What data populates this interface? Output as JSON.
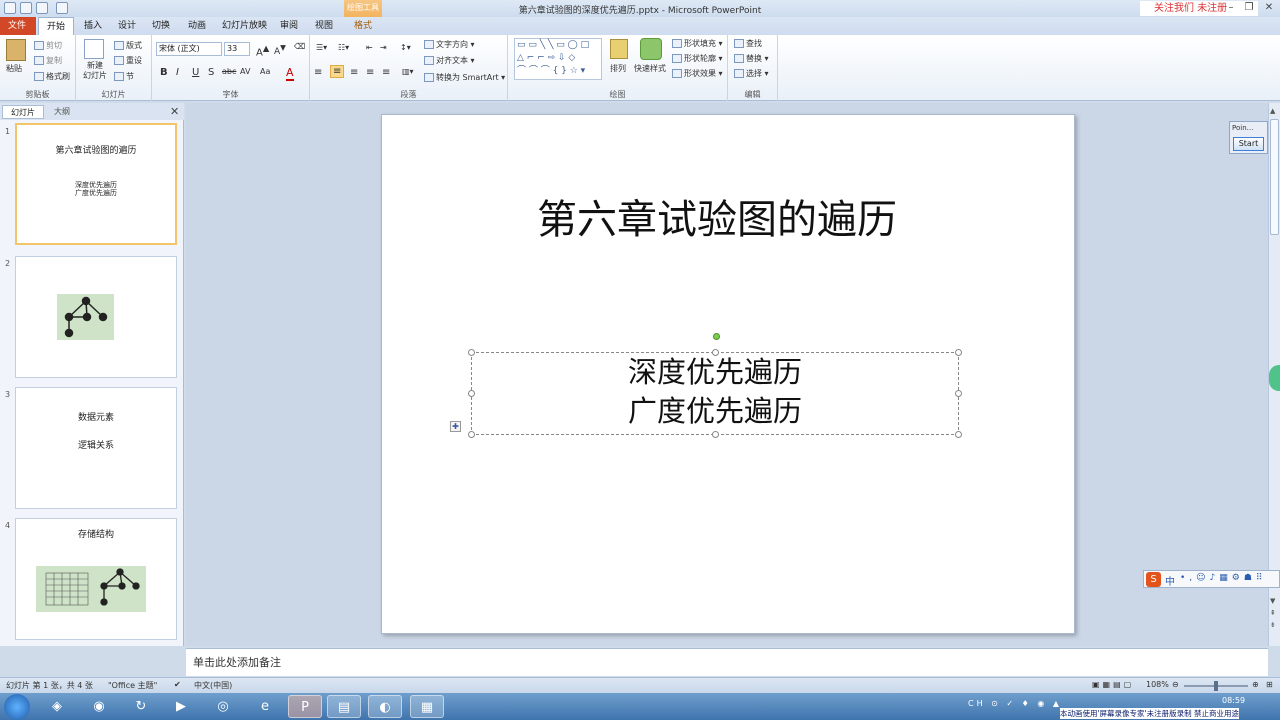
{
  "window": {
    "title": "第六章试验图的深度优先遍历.pptx - Microsoft PowerPoint",
    "context_tab_header": "绘图工具",
    "watermark": "关注我们 未注册"
  },
  "tabs": [
    "文件",
    "开始",
    "插入",
    "设计",
    "切换",
    "动画",
    "幻灯片放映",
    "审阅",
    "视图",
    "格式"
  ],
  "ribbon": {
    "clipboard": {
      "paste": "粘贴",
      "cut": "剪切",
      "copy": "复制",
      "format_painter": "格式刷",
      "label": "剪贴板"
    },
    "slides": {
      "new_slide": "新建\n幻灯片",
      "layout": "版式",
      "reset": "重设",
      "section": "节",
      "label": "幻灯片"
    },
    "font": {
      "family": "宋体 (正文)",
      "size": "33",
      "label": "字体",
      "buttons": [
        "B",
        "I",
        "U",
        "S",
        "abc",
        "AV",
        "Aa",
        "A"
      ]
    },
    "paragraph": {
      "text_direction": "文字方向",
      "align_text": "对齐文本",
      "smartart": "转换为 SmartArt",
      "label": "段落"
    },
    "drawing": {
      "arrange": "排列",
      "quick_styles": "快速样式",
      "shape_fill": "形状填充",
      "shape_outline": "形状轮廓",
      "shape_effects": "形状效果",
      "label": "绘图"
    },
    "editing": {
      "find": "查找",
      "replace": "替换",
      "select": "选择",
      "label": "编辑"
    }
  },
  "pane": {
    "tabs": [
      "幻灯片",
      "大纲"
    ]
  },
  "thumbnails": [
    {
      "num": "1",
      "title": "第六章试验图的遍历",
      "lines": [
        "深度优先遍历",
        "广度优先遍历"
      ]
    },
    {
      "num": "2"
    },
    {
      "num": "3",
      "lines": [
        "数据元素",
        "逻辑关系"
      ]
    },
    {
      "num": "4",
      "title": "存储结构"
    }
  ],
  "slide": {
    "title": "第六章试验图的遍历",
    "body_line1": "深度优先遍历",
    "body_line2": "广度优先遍历"
  },
  "notes_placeholder": "单击此处添加备注",
  "status": {
    "slide_info": "幻灯片 第 1 张，共 4 张",
    "theme": "\"Office 主题\"",
    "language": "中文(中国)",
    "zoom": "108%"
  },
  "pointer_panel": {
    "title": "Poin...",
    "button": "Start"
  },
  "taskbar": {
    "time": "08:59",
    "notice": "本动画使用'屏幕录像专家'未注册版录制 禁止商业用途",
    "ime": "中"
  }
}
